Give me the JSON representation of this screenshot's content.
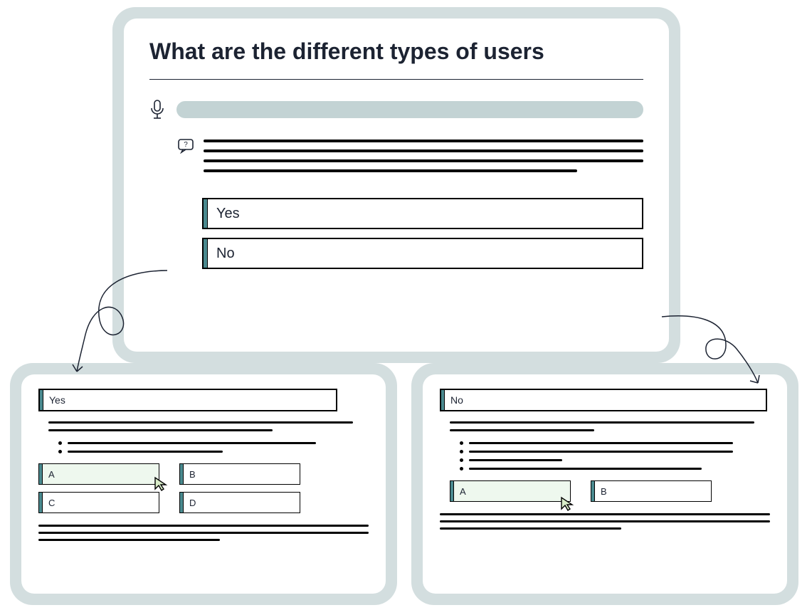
{
  "main": {
    "title": "What are the different types of users",
    "options": [
      "Yes",
      "No"
    ]
  },
  "left": {
    "header": "Yes",
    "choices": [
      "A",
      "B",
      "C",
      "D"
    ],
    "selected": 0
  },
  "right": {
    "header": "No",
    "choices": [
      "A",
      "B"
    ],
    "selected": 0
  }
}
